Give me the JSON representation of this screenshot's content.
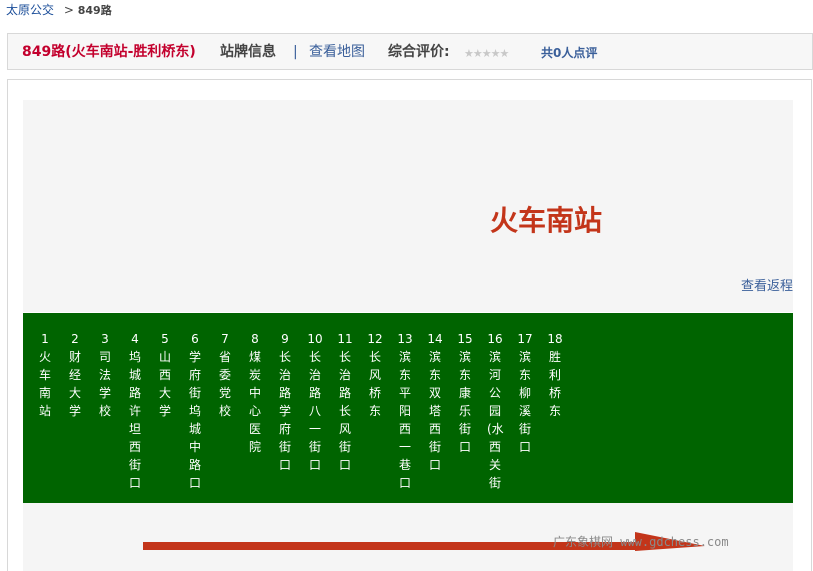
{
  "breadcrumb": {
    "home": "太原公交",
    "separator": ">",
    "current": "849路"
  },
  "header": {
    "title": "849路(火车南站-胜利桥东)",
    "info": "站牌信息",
    "divider": "|",
    "map_link": "查看地图",
    "rating_label": "综合评价:",
    "stars": "★★★★★",
    "rating_count": "共0人点评"
  },
  "station": {
    "name": "火车南站",
    "return_link": "查看返程"
  },
  "stops": [
    {
      "num": "1",
      "name": "火车南站"
    },
    {
      "num": "2",
      "name": "财经大学"
    },
    {
      "num": "3",
      "name": "司法学校"
    },
    {
      "num": "4",
      "name": "坞城路许坦西街口"
    },
    {
      "num": "5",
      "name": "山西大学"
    },
    {
      "num": "6",
      "name": "学府街坞城中路口"
    },
    {
      "num": "7",
      "name": "省委党校"
    },
    {
      "num": "8",
      "name": "煤炭中心医院"
    },
    {
      "num": "9",
      "name": "长治路学府街口"
    },
    {
      "num": "10",
      "name": "长治路八一街口"
    },
    {
      "num": "11",
      "name": "长治路长风街口"
    },
    {
      "num": "12",
      "name": "长风桥东"
    },
    {
      "num": "13",
      "name": "滨东平阳西一巷口"
    },
    {
      "num": "14",
      "name": "滨东双塔西街口"
    },
    {
      "num": "15",
      "name": "滨东康乐街口"
    },
    {
      "num": "16",
      "name": "滨河公园(水西关街"
    },
    {
      "num": "17",
      "name": "滨东柳溪街口"
    },
    {
      "num": "18",
      "name": "胜利桥东"
    }
  ],
  "watermark": "广东象棋网 www.gdchess.com",
  "colors": {
    "title_red": "#c3002d",
    "station_red": "#c3351a",
    "stops_green": "#006400",
    "link_blue": "#3a5f9a",
    "arrow_red": "#c3351a"
  }
}
